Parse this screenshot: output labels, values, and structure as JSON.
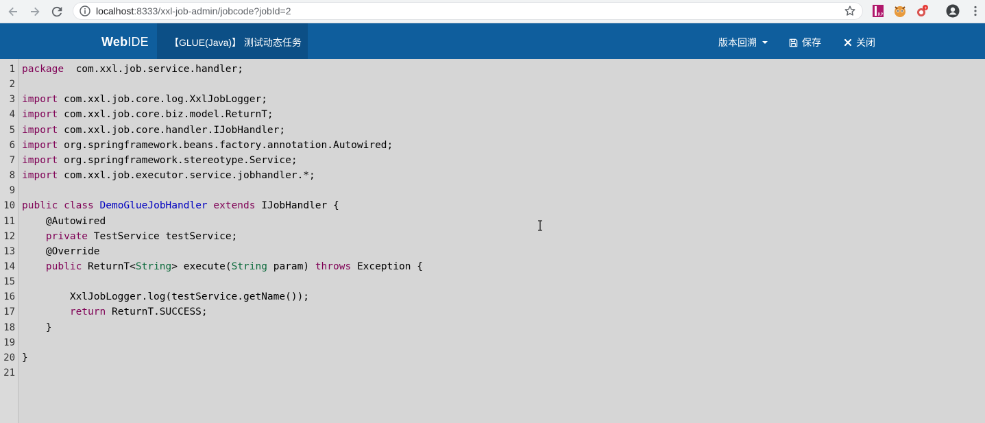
{
  "browser": {
    "url_host": "localhost",
    "url_rest": ":8333/xxl-job-admin/jobcode?jobId=2",
    "extension_icons": [
      "rp-icon",
      "tampermonkey-icon",
      "ext-bug-icon"
    ]
  },
  "header": {
    "brand_bold": "Web",
    "brand_rest": "IDE",
    "task_title": "【GLUE(Java)】 测试动态任务",
    "version_label": "版本回溯",
    "save_label": "保存",
    "close_label": "关闭"
  },
  "editor": {
    "lines": [
      {
        "n": "1",
        "t": [
          [
            "kw",
            "package"
          ],
          [
            "",
            "  com.xxl.job.service.handler;"
          ]
        ]
      },
      {
        "n": "2",
        "t": []
      },
      {
        "n": "3",
        "t": [
          [
            "kw",
            "import"
          ],
          [
            "",
            " com.xxl.job.core.log.XxlJobLogger;"
          ]
        ]
      },
      {
        "n": "4",
        "t": [
          [
            "kw",
            "import"
          ],
          [
            "",
            " com.xxl.job.core.biz.model.ReturnT;"
          ]
        ]
      },
      {
        "n": "5",
        "t": [
          [
            "kw",
            "import"
          ],
          [
            "",
            " com.xxl.job.core.handler.IJobHandler;"
          ]
        ]
      },
      {
        "n": "6",
        "t": [
          [
            "kw",
            "import"
          ],
          [
            "",
            " org.springframework.beans.factory.annotation.Autowired;"
          ]
        ]
      },
      {
        "n": "7",
        "t": [
          [
            "kw",
            "import"
          ],
          [
            "",
            " org.springframework.stereotype.Service;"
          ]
        ]
      },
      {
        "n": "8",
        "t": [
          [
            "kw",
            "import"
          ],
          [
            "",
            " com.xxl.job.executor.service.jobhandler.*;"
          ]
        ]
      },
      {
        "n": "9",
        "t": []
      },
      {
        "n": "10",
        "t": [
          [
            "kw",
            "public"
          ],
          [
            "",
            " "
          ],
          [
            "kw",
            "class"
          ],
          [
            "",
            " "
          ],
          [
            "def",
            "DemoGlueJobHandler"
          ],
          [
            "",
            " "
          ],
          [
            "kw",
            "extends"
          ],
          [
            "",
            " IJobHandler {"
          ]
        ]
      },
      {
        "n": "11",
        "t": [
          [
            "",
            "    @Autowired"
          ]
        ]
      },
      {
        "n": "12",
        "t": [
          [
            "",
            "    "
          ],
          [
            "kw",
            "private"
          ],
          [
            "",
            " TestService testService;"
          ]
        ]
      },
      {
        "n": "13",
        "t": [
          [
            "",
            "    @Override"
          ]
        ]
      },
      {
        "n": "14",
        "t": [
          [
            "",
            "    "
          ],
          [
            "kw",
            "public"
          ],
          [
            "",
            " ReturnT<"
          ],
          [
            "type",
            "String"
          ],
          [
            "",
            "> execute("
          ],
          [
            "type",
            "String"
          ],
          [
            "",
            " param) "
          ],
          [
            "kw",
            "throws"
          ],
          [
            "",
            " Exception {"
          ]
        ]
      },
      {
        "n": "15",
        "t": []
      },
      {
        "n": "16",
        "t": [
          [
            "",
            "        XxlJobLogger.log(testService.getName());"
          ]
        ]
      },
      {
        "n": "17",
        "t": [
          [
            "",
            "        "
          ],
          [
            "kw",
            "return"
          ],
          [
            "",
            " ReturnT.SUCCESS;"
          ]
        ]
      },
      {
        "n": "18",
        "t": [
          [
            "",
            "    }"
          ]
        ]
      },
      {
        "n": "19",
        "t": []
      },
      {
        "n": "20",
        "t": [
          [
            "",
            "}"
          ]
        ]
      },
      {
        "n": "21",
        "t": []
      }
    ]
  }
}
